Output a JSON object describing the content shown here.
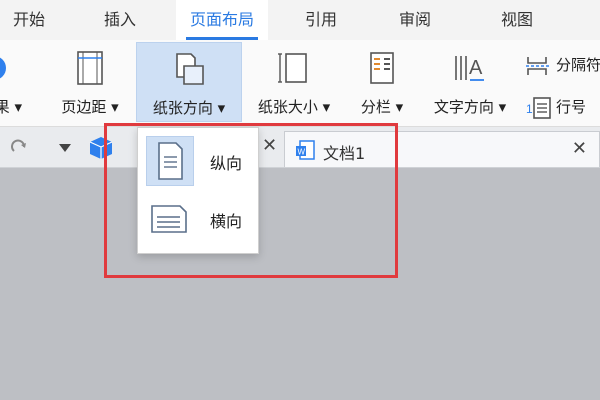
{
  "menu_tabs": [
    {
      "label": "开始"
    },
    {
      "label": "插入"
    },
    {
      "label": "页面布局"
    },
    {
      "label": "引用"
    },
    {
      "label": "审阅"
    },
    {
      "label": "视图"
    }
  ],
  "ribbon": {
    "partial_left_label": "果",
    "page_margins_label": "页边距",
    "orientation_label": "纸张方向",
    "paper_size_label": "纸张大小",
    "columns_label": "分栏",
    "text_direction_label": "文字方向",
    "separator_label": "分隔符",
    "line_numbers_label": "行号"
  },
  "document_tab": {
    "title": "文档1"
  },
  "orientation_menu": {
    "portrait_label": "纵向",
    "landscape_label": "横向",
    "selected": "portrait"
  },
  "colors": {
    "accent": "#2a7ae2",
    "highlight_box": "#e03a3e",
    "selected_bg": "#cfe0f5"
  }
}
